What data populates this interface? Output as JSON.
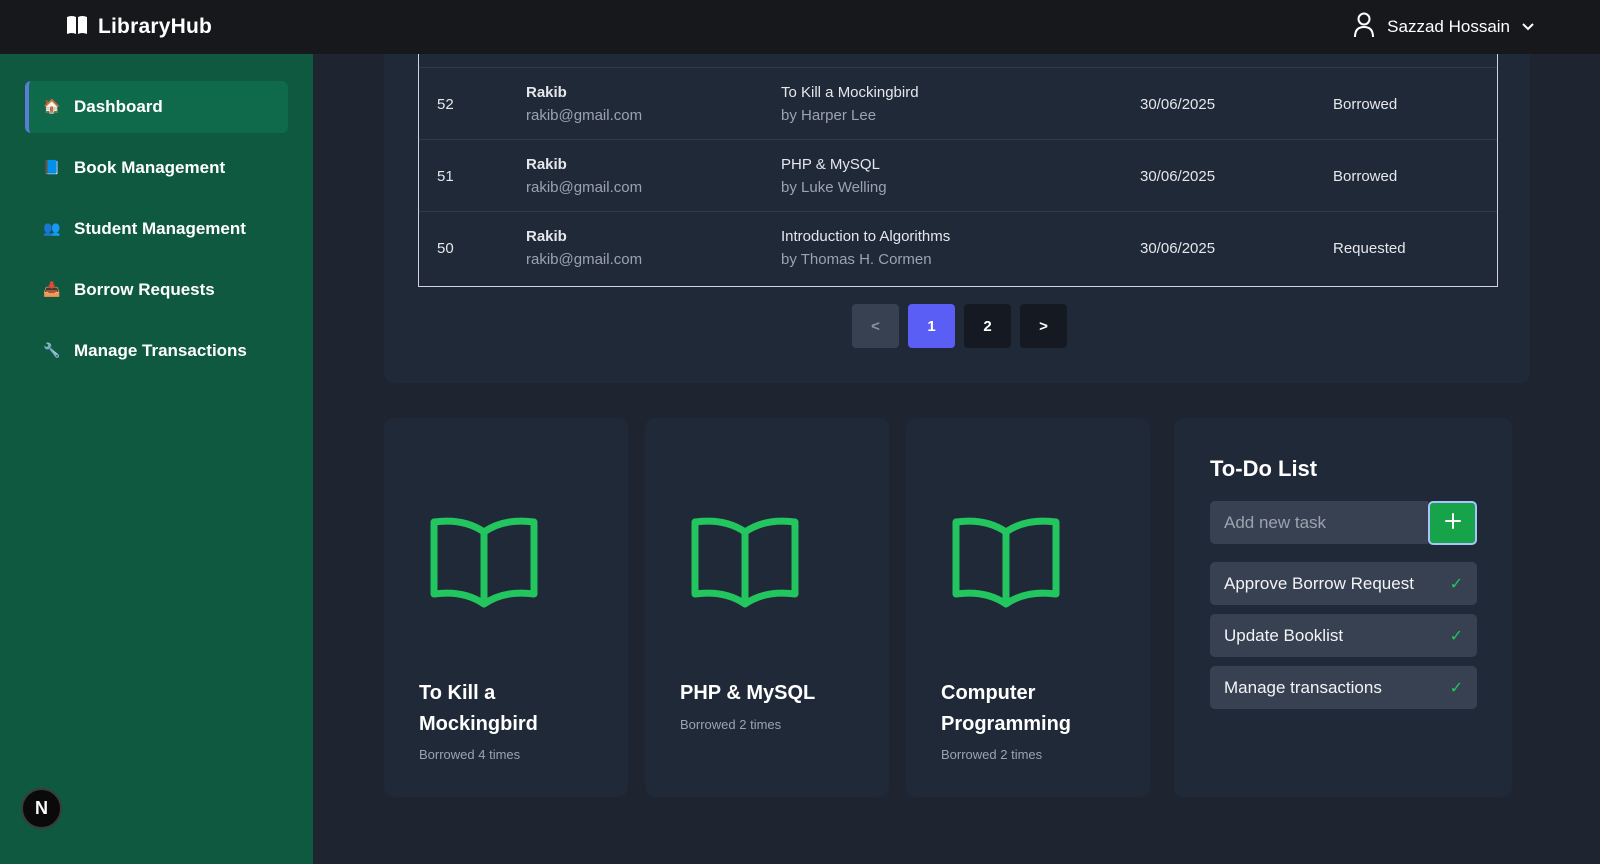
{
  "app": {
    "title": "LibraryHub",
    "logo_icon": "book-open-icon"
  },
  "user": {
    "name": "Sazzad Hossain",
    "icon": "user-icon"
  },
  "sidebar": {
    "items": [
      {
        "label": "Dashboard",
        "icon": "🏠",
        "active": true
      },
      {
        "label": "Book Management",
        "icon": "📘",
        "active": false
      },
      {
        "label": "Student Management",
        "icon": "👥",
        "active": false
      },
      {
        "label": "Borrow Requests",
        "icon": "📥",
        "active": false
      },
      {
        "label": "Manage Transactions",
        "icon": "🔧",
        "active": false
      }
    ],
    "badge": "N"
  },
  "transactions": {
    "rows": [
      {
        "id": "52",
        "name": "Rakib",
        "email": "rakib@gmail.com",
        "book": "To Kill a Mockingbird",
        "author": "by Harper Lee",
        "date": "30/06/2025",
        "status": "Borrowed"
      },
      {
        "id": "51",
        "name": "Rakib",
        "email": "rakib@gmail.com",
        "book": "PHP & MySQL",
        "author": "by Luke Welling",
        "date": "30/06/2025",
        "status": "Borrowed"
      },
      {
        "id": "50",
        "name": "Rakib",
        "email": "rakib@gmail.com",
        "book": "Introduction to Algorithms",
        "author": "by Thomas H. Cormen",
        "date": "30/06/2025",
        "status": "Requested"
      }
    ]
  },
  "pagination": {
    "prev": "<",
    "pages": [
      "1",
      "2"
    ],
    "current": "1",
    "next": ">"
  },
  "popular_books": [
    {
      "title": "To Kill a Mockingbird",
      "subtitle": "Borrowed 4 times"
    },
    {
      "title": "PHP & MySQL",
      "subtitle": "Borrowed 2 times"
    },
    {
      "title": "Computer Programming",
      "subtitle": "Borrowed 2 times"
    }
  ],
  "todo": {
    "title": "To-Do List",
    "placeholder": "Add new task",
    "add_label": "+",
    "tasks": [
      {
        "label": "Approve Borrow Request",
        "check": "✓"
      },
      {
        "label": "Update Booklist",
        "check": "✓"
      },
      {
        "label": "Manage transactions",
        "check": "✓"
      }
    ]
  },
  "colors": {
    "accent_green": "#22c55e",
    "sidebar": "#0e5940",
    "page_active": "#5b5ef5"
  }
}
